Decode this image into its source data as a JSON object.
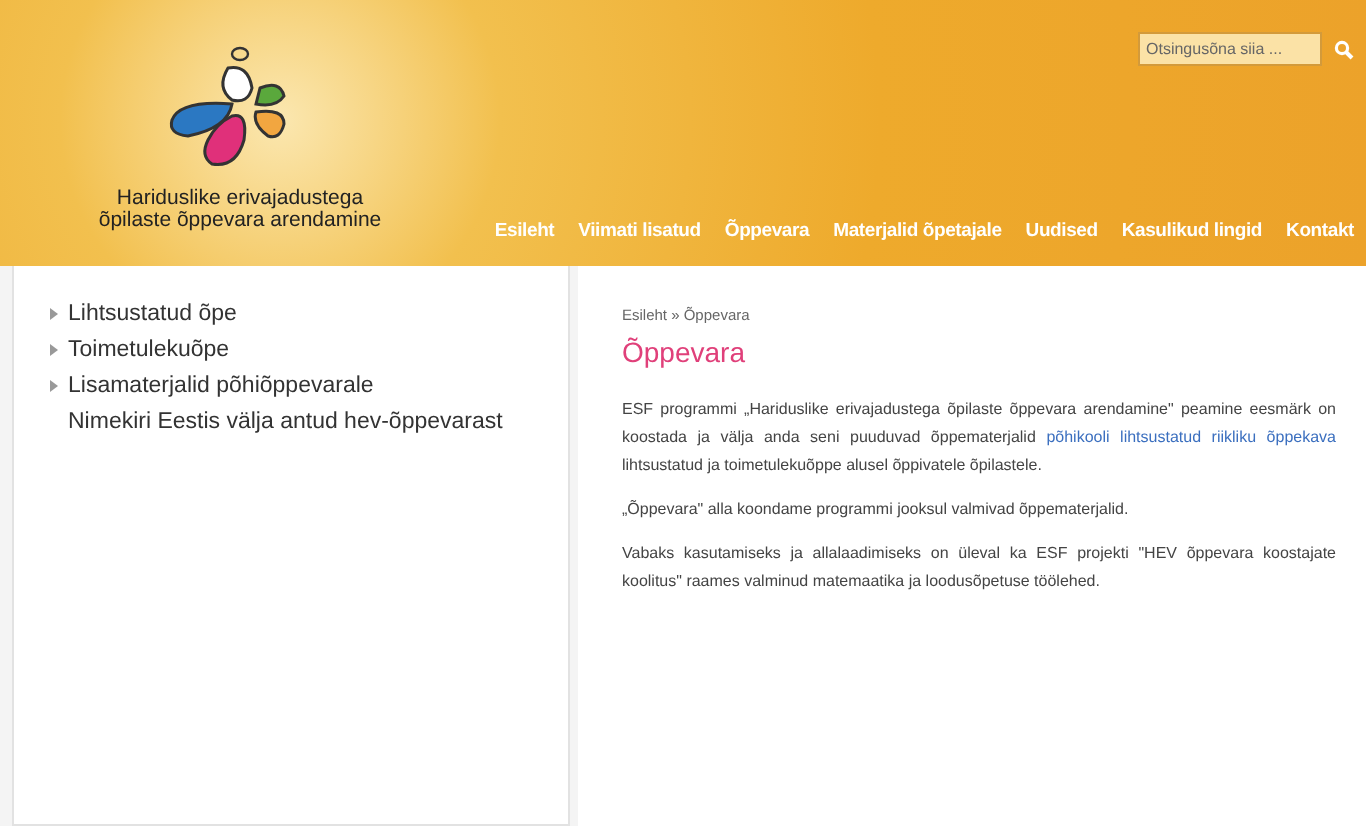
{
  "header": {
    "logo_text": [
      "Hariduslike erivajadustega",
      "õpilaste õppevara arendamine"
    ],
    "search": {
      "placeholder": "Otsingusõna siia ..."
    },
    "nav": [
      "Esileht",
      "Viimati lisatud",
      "Õppevara",
      "Materjalid õpetajale",
      "Uudised",
      "Kasulikud lingid",
      "Kontakt"
    ]
  },
  "sidebar": {
    "items": [
      {
        "label": "Lihtsustatud õpe",
        "kind": "arrow"
      },
      {
        "label": "Toimetulekuõpe",
        "kind": "arrow"
      },
      {
        "label": "Lisamaterjalid põhiõppevarale",
        "kind": "arrow"
      },
      {
        "label": "Nimekiri Eestis välja antud hev-õppevarast",
        "kind": "plain"
      }
    ]
  },
  "content": {
    "breadcrumb": "Esileht » Õppevara",
    "title": "Õppevara",
    "paragraphs": [
      [
        {
          "kind": "text",
          "text": "ESF programmi „Hariduslike erivajadustega õpilaste õppevara arendamine\" peamine eesmärk on koostada ja välja anda seni puuduvad õppematerjalid "
        },
        {
          "kind": "link",
          "text": "põhikooli lihtsustatud riikliku õppekava"
        },
        {
          "kind": "text",
          "text": " lihtsustatud ja toimetulekuõppe alusel õppivatele õpilastele."
        }
      ],
      [
        {
          "kind": "text",
          "text": "„Õppevara\"  alla koondame programmi jooksul valmivad õppematerjalid."
        }
      ],
      [
        {
          "kind": "text",
          "text": "Vabaks kasutamiseks ja allalaadimiseks on üleval ka ESF projekti \"HEV õppevara koostajate koolitus\" raames valminud matemaatika ja loodusõpetuse töölehed."
        }
      ]
    ]
  }
}
